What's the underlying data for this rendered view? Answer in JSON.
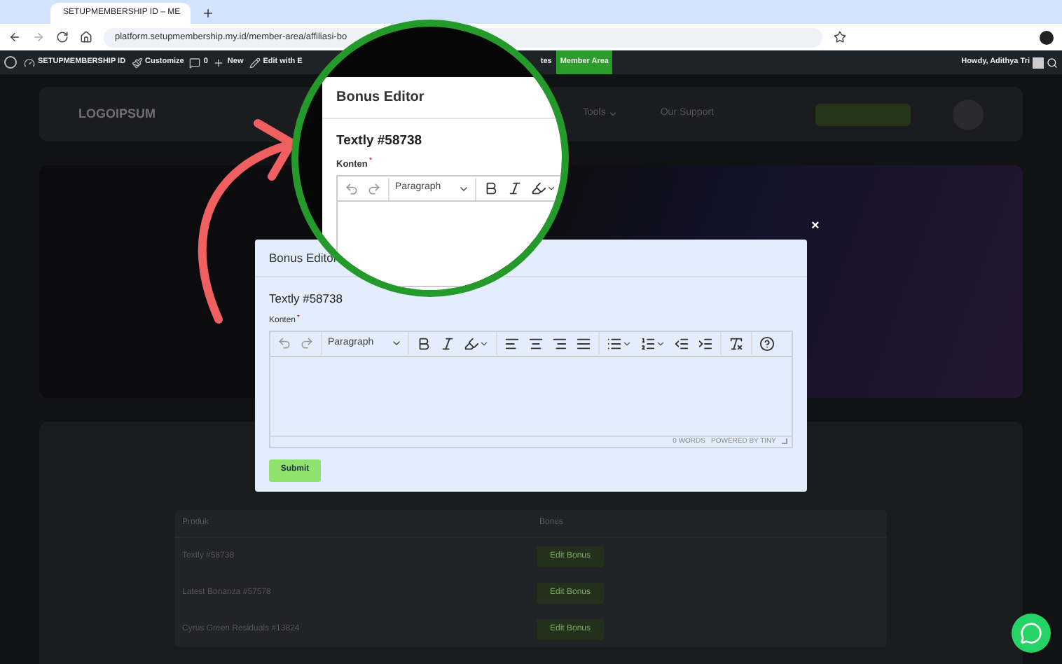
{
  "browser": {
    "tab_title": "SETUPMEMBERSHIP ID – ME",
    "url": "platform.setupmembership.my.id/member-area/affiliasi-bo"
  },
  "admin_bar": {
    "items": [
      {
        "label": "SETUPMEMBERSHIP ID",
        "highlighted": false
      },
      {
        "label": "Customize",
        "highlighted": false
      },
      {
        "label": "0",
        "highlighted": false
      },
      {
        "label": "New",
        "highlighted": false
      },
      {
        "label": "Edit with E",
        "highlighted": false
      },
      {
        "label": "tes",
        "highlighted": false
      },
      {
        "label": "Member Area",
        "highlighted": true
      }
    ],
    "greeting": "Howdy, Adithya Tri"
  },
  "site_nav": {
    "logo": "LOGOIPSUM",
    "links": [
      {
        "label": "Tools",
        "dropdown": true
      },
      {
        "label": "Our Support",
        "dropdown": false
      }
    ]
  },
  "table": {
    "columns": [
      "Produk",
      "Bonus"
    ],
    "rows": [
      {
        "product": "Textly #58738",
        "action": "Edit Bonus"
      },
      {
        "product": "Latest Bonanza #57578",
        "action": "Edit Bonus"
      },
      {
        "product": "Cyrus Green Residuals #13824",
        "action": "Edit Bonus"
      }
    ]
  },
  "modal": {
    "title": "Bonus Editor",
    "product": "Textly #58738",
    "field_label": "Konten",
    "required_mark": "*",
    "block_style": "Paragraph",
    "word_count": "0 WORDS",
    "branding": "POWERED BY TINY",
    "submit": "Submit",
    "close": "×"
  },
  "magnifier": {
    "title": "Bonus Editor",
    "product": "Textly #58738",
    "field_label": "Konten",
    "required_mark": "*",
    "block_style": "Paragraph"
  }
}
